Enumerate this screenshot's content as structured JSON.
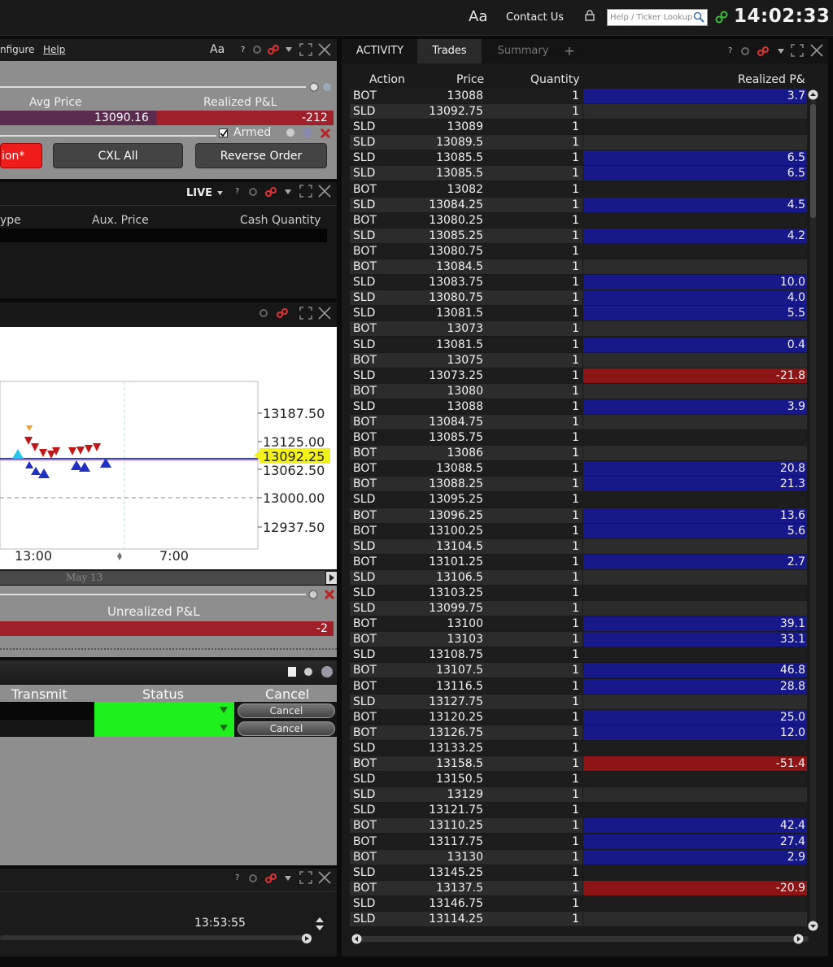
{
  "topbar": {
    "font_icon": "Aa",
    "contact": "Contact Us",
    "search_placeholder": "Help / Ticker Lookup",
    "clock": "14:02:33"
  },
  "order_panel": {
    "menu": [
      "nfigure",
      "Help"
    ],
    "font_icon": "Aa",
    "avg_price_label": "Avg Price",
    "realized_label": "Realized P&L",
    "avg_price": "13090.16",
    "realized": "-212",
    "armed_label": "Armed",
    "button_action": "ion*",
    "button_cxl": "CXL All",
    "button_reverse": "Reverse Order"
  },
  "orders_panel": {
    "live": "LIVE",
    "cols": [
      "ype",
      "Aux. Price",
      "Cash Quantity"
    ]
  },
  "chart": {
    "price_labels": [
      "13187.50",
      "13125.00",
      "13092.25",
      "13062.50",
      "13000.00",
      "12937.50"
    ],
    "time_labels": [
      "13:00",
      "7:00"
    ],
    "date_label": "May 13"
  },
  "position_panel": {
    "unrealized_label": "Unrealized P&L",
    "unrealized": "-2"
  },
  "order_status_panel": {
    "cols": [
      "Transmit",
      "Status",
      "Cancel"
    ],
    "cancel_buttons": [
      "Cancel",
      "Cancel"
    ]
  },
  "bottom_panel": {
    "time": "13:53:55"
  },
  "trades_panel": {
    "tabs": [
      "ACTIVITY",
      "Trades",
      "Summary",
      "+"
    ],
    "headers": [
      "Action",
      "Price",
      "Quantity",
      "Realized P&"
    ],
    "rows": [
      {
        "a": "BOT",
        "p": "13088",
        "q": "1",
        "r": "3.7"
      },
      {
        "a": "SLD",
        "p": "13092.75",
        "q": "1",
        "r": ""
      },
      {
        "a": "SLD",
        "p": "13089",
        "q": "1",
        "r": ""
      },
      {
        "a": "SLD",
        "p": "13089.5",
        "q": "1",
        "r": ""
      },
      {
        "a": "SLD",
        "p": "13085.5",
        "q": "1",
        "r": "6.5"
      },
      {
        "a": "SLD",
        "p": "13085.5",
        "q": "1",
        "r": "6.5"
      },
      {
        "a": "BOT",
        "p": "13082",
        "q": "1",
        "r": ""
      },
      {
        "a": "SLD",
        "p": "13084.25",
        "q": "1",
        "r": "4.5"
      },
      {
        "a": "BOT",
        "p": "13080.25",
        "q": "1",
        "r": ""
      },
      {
        "a": "SLD",
        "p": "13085.25",
        "q": "1",
        "r": "4.2"
      },
      {
        "a": "BOT",
        "p": "13080.75",
        "q": "1",
        "r": ""
      },
      {
        "a": "BOT",
        "p": "13084.5",
        "q": "1",
        "r": ""
      },
      {
        "a": "SLD",
        "p": "13083.75",
        "q": "1",
        "r": "10.0"
      },
      {
        "a": "SLD",
        "p": "13080.75",
        "q": "1",
        "r": "4.0"
      },
      {
        "a": "SLD",
        "p": "13081.5",
        "q": "1",
        "r": "5.5"
      },
      {
        "a": "BOT",
        "p": "13073",
        "q": "1",
        "r": ""
      },
      {
        "a": "SLD",
        "p": "13081.5",
        "q": "1",
        "r": "0.4"
      },
      {
        "a": "BOT",
        "p": "13075",
        "q": "1",
        "r": ""
      },
      {
        "a": "SLD",
        "p": "13073.25",
        "q": "1",
        "r": "-21.8"
      },
      {
        "a": "BOT",
        "p": "13080",
        "q": "1",
        "r": ""
      },
      {
        "a": "SLD",
        "p": "13088",
        "q": "1",
        "r": "3.9"
      },
      {
        "a": "BOT",
        "p": "13084.75",
        "q": "1",
        "r": ""
      },
      {
        "a": "BOT",
        "p": "13085.75",
        "q": "1",
        "r": ""
      },
      {
        "a": "BOT",
        "p": "13086",
        "q": "1",
        "r": ""
      },
      {
        "a": "BOT",
        "p": "13088.5",
        "q": "1",
        "r": "20.8"
      },
      {
        "a": "BOT",
        "p": "13088.25",
        "q": "1",
        "r": "21.3"
      },
      {
        "a": "SLD",
        "p": "13095.25",
        "q": "1",
        "r": ""
      },
      {
        "a": "BOT",
        "p": "13096.25",
        "q": "1",
        "r": "13.6"
      },
      {
        "a": "BOT",
        "p": "13100.25",
        "q": "1",
        "r": "5.6"
      },
      {
        "a": "SLD",
        "p": "13104.5",
        "q": "1",
        "r": ""
      },
      {
        "a": "BOT",
        "p": "13101.25",
        "q": "1",
        "r": "2.7"
      },
      {
        "a": "SLD",
        "p": "13106.5",
        "q": "1",
        "r": ""
      },
      {
        "a": "SLD",
        "p": "13103.25",
        "q": "1",
        "r": ""
      },
      {
        "a": "SLD",
        "p": "13099.75",
        "q": "1",
        "r": ""
      },
      {
        "a": "BOT",
        "p": "13100",
        "q": "1",
        "r": "39.1"
      },
      {
        "a": "BOT",
        "p": "13103",
        "q": "1",
        "r": "33.1"
      },
      {
        "a": "SLD",
        "p": "13108.75",
        "q": "1",
        "r": ""
      },
      {
        "a": "BOT",
        "p": "13107.5",
        "q": "1",
        "r": "46.8"
      },
      {
        "a": "BOT",
        "p": "13116.5",
        "q": "1",
        "r": "28.8"
      },
      {
        "a": "SLD",
        "p": "13127.75",
        "q": "1",
        "r": ""
      },
      {
        "a": "BOT",
        "p": "13120.25",
        "q": "1",
        "r": "25.0"
      },
      {
        "a": "BOT",
        "p": "13126.75",
        "q": "1",
        "r": "12.0"
      },
      {
        "a": "SLD",
        "p": "13133.25",
        "q": "1",
        "r": ""
      },
      {
        "a": "BOT",
        "p": "13158.5",
        "q": "1",
        "r": "-51.4"
      },
      {
        "a": "SLD",
        "p": "13150.5",
        "q": "1",
        "r": ""
      },
      {
        "a": "SLD",
        "p": "13129",
        "q": "1",
        "r": ""
      },
      {
        "a": "SLD",
        "p": "13121.75",
        "q": "1",
        "r": ""
      },
      {
        "a": "BOT",
        "p": "13110.25",
        "q": "1",
        "r": "42.4"
      },
      {
        "a": "BOT",
        "p": "13117.75",
        "q": "1",
        "r": "27.4"
      },
      {
        "a": "BOT",
        "p": "13130",
        "q": "1",
        "r": "2.9"
      },
      {
        "a": "SLD",
        "p": "13145.25",
        "q": "1",
        "r": ""
      },
      {
        "a": "BOT",
        "p": "13137.5",
        "q": "1",
        "r": "-20.9"
      },
      {
        "a": "SLD",
        "p": "13146.75",
        "q": "1",
        "r": ""
      },
      {
        "a": "SLD",
        "p": "13114.25",
        "q": "1",
        "r": ""
      }
    ]
  },
  "colors": {
    "positive": "#17188a",
    "negative": "#8c1414",
    "row_dark": "#1d1d1d",
    "row_light": "#2c2c2c",
    "status_green": "#1df01d",
    "highlight_yellow": "#f2f21a"
  }
}
